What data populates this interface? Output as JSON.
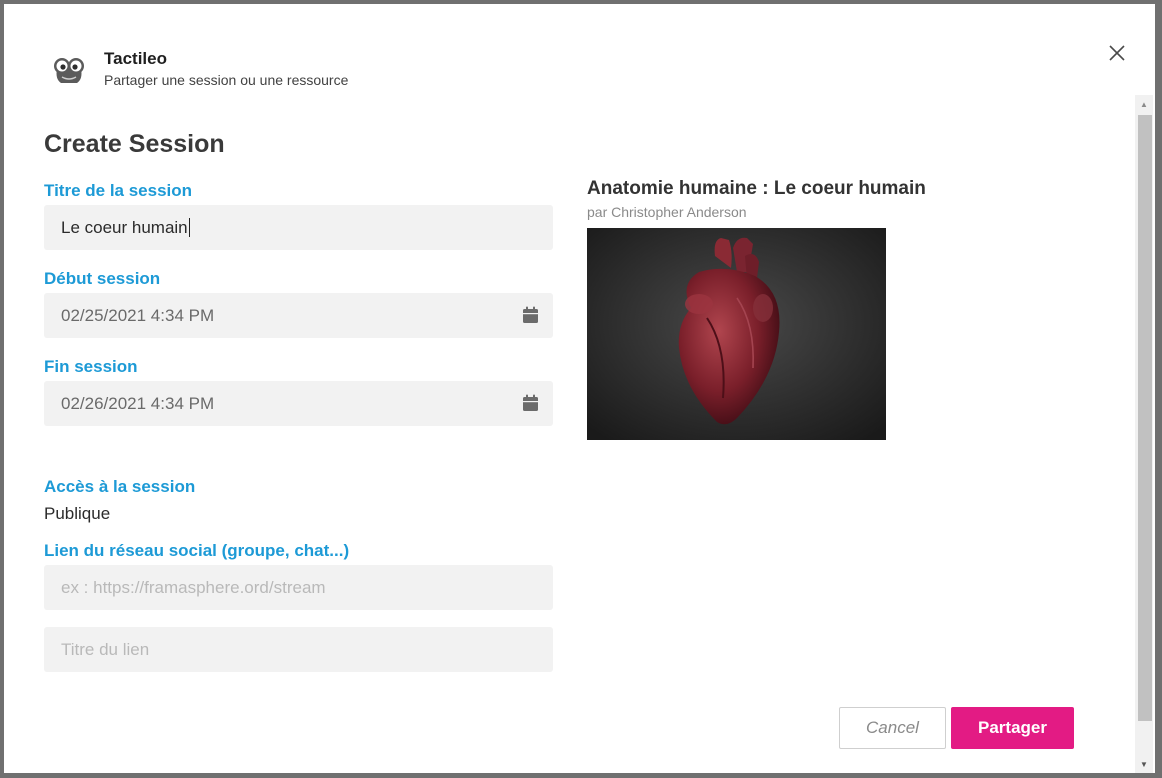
{
  "app": {
    "name": "Tactileo",
    "subtitle": "Partager une session ou une ressource"
  },
  "form": {
    "title": "Create Session",
    "session_title_label": "Titre de la session",
    "session_title_value": "Le coeur humain",
    "start_label": "Début session",
    "start_value": "02/25/2021 4:34 PM",
    "end_label": "Fin session",
    "end_value": "02/26/2021 4:34 PM",
    "access_label": "Accès à la session",
    "access_value": "Publique",
    "social_label": "Lien du réseau social (groupe, chat...)",
    "social_link_placeholder": "ex : https://framasphere.ord/stream",
    "link_title_placeholder": "Titre du lien"
  },
  "resource": {
    "title": "Anatomie humaine : Le coeur humain",
    "author": "par Christopher Anderson"
  },
  "actions": {
    "cancel_label": "Cancel",
    "share_label": "Partager"
  },
  "colors": {
    "label_accent": "#1d9ad6",
    "share_button": "#e31b84"
  },
  "icons": {
    "app": "tactileo-logo-icon",
    "close": "close-icon",
    "calendar": "calendar-icon"
  }
}
